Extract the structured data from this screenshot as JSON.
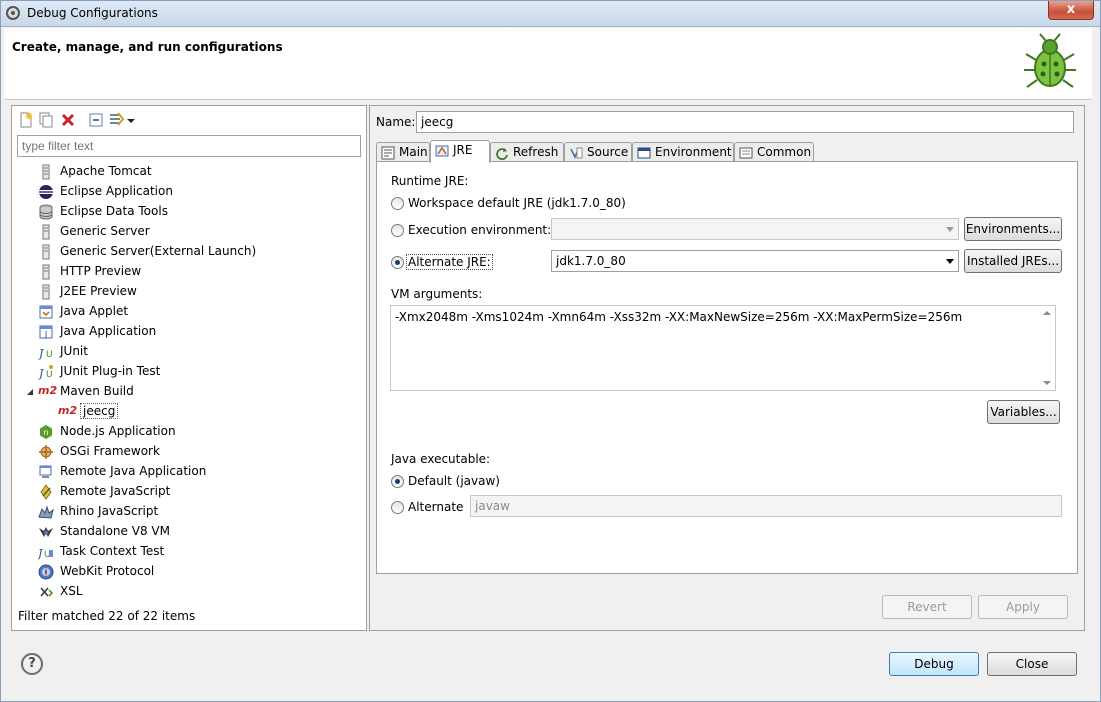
{
  "window": {
    "title": "Debug Configurations",
    "close_label": "x"
  },
  "banner": {
    "title": "Create, manage, and run configurations"
  },
  "left": {
    "filter_placeholder": "type filter text",
    "items": [
      {
        "label": "Apache Tomcat",
        "icon": "tomcat-icon"
      },
      {
        "label": "Eclipse Application",
        "icon": "eclipse-icon"
      },
      {
        "label": "Eclipse Data Tools",
        "icon": "database-icon"
      },
      {
        "label": "Generic Server",
        "icon": "server-icon"
      },
      {
        "label": "Generic Server(External Launch)",
        "icon": "server-icon"
      },
      {
        "label": "HTTP Preview",
        "icon": "server-icon"
      },
      {
        "label": "J2EE Preview",
        "icon": "server-icon"
      },
      {
        "label": "Java Applet",
        "icon": "applet-icon"
      },
      {
        "label": "Java Application",
        "icon": "java-app-icon"
      },
      {
        "label": "JUnit",
        "icon": "junit-icon"
      },
      {
        "label": "JUnit Plug-in Test",
        "icon": "junit-plugin-icon"
      },
      {
        "label": "Maven Build",
        "icon": "maven-icon"
      },
      {
        "label": "jeecg",
        "icon": "maven-icon"
      },
      {
        "label": "Node.js Application",
        "icon": "nodejs-icon"
      },
      {
        "label": "OSGi Framework",
        "icon": "osgi-icon"
      },
      {
        "label": "Remote Java Application",
        "icon": "remote-java-icon"
      },
      {
        "label": "Remote JavaScript",
        "icon": "remote-js-icon"
      },
      {
        "label": "Rhino JavaScript",
        "icon": "rhino-icon"
      },
      {
        "label": "Standalone V8 VM",
        "icon": "v8-icon"
      },
      {
        "label": "Task Context Test",
        "icon": "task-test-icon"
      },
      {
        "label": "WebKit Protocol",
        "icon": "webkit-icon"
      },
      {
        "label": "XSL",
        "icon": "xsl-icon"
      }
    ],
    "maven_badge": "m2",
    "footer": "Filter matched 22 of 22 items"
  },
  "right": {
    "name_label": "Name:",
    "name_value": "jeecg",
    "tabs": [
      {
        "label": "Main",
        "icon": "main-tab-icon"
      },
      {
        "label": "JRE",
        "icon": "jre-tab-icon"
      },
      {
        "label": "Refresh",
        "icon": "refresh-icon"
      },
      {
        "label": "Source",
        "icon": "source-icon"
      },
      {
        "label": "Environment",
        "icon": "environment-icon"
      },
      {
        "label": "Common",
        "icon": "common-icon"
      }
    ],
    "runtime": {
      "group_label": "Runtime JRE:",
      "workspace_label": "Workspace default JRE (jdk1.7.0_80)",
      "exec_env_label": "Execution environment:",
      "exec_env_value": "",
      "environments_button": "Environments...",
      "alternate_label": "Alternate JRE:",
      "alternate_value": "jdk1.7.0_80",
      "installed_button": "Installed JREs..."
    },
    "vm": {
      "group_label": "VM arguments:",
      "value": "-Xmx2048m -Xms1024m -Xmn64m -Xss32m -XX:MaxNewSize=256m -XX:MaxPermSize=256m",
      "variables_button": "Variables..."
    },
    "java_exec": {
      "group_label": "Java executable:",
      "default_label": "Default (javaw)",
      "alternate_label": "Alternate",
      "alternate_value": "javaw"
    },
    "revert_button": "Revert",
    "apply_button": "Apply"
  },
  "bottom": {
    "help": "?",
    "debug_button": "Debug",
    "close_button": "Close"
  }
}
